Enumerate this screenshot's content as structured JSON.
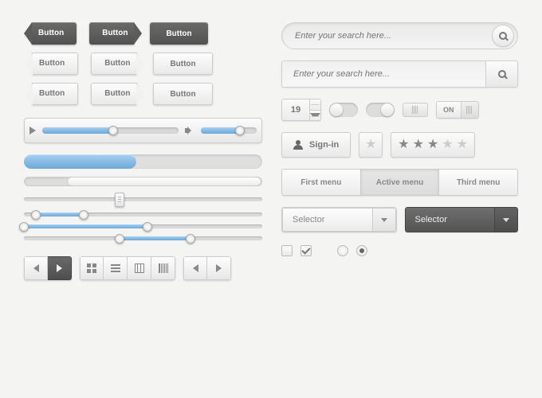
{
  "buttons": {
    "row1": [
      "Button",
      "Button",
      "Button"
    ],
    "row2": [
      "Button",
      "Button",
      "Button"
    ],
    "row3": [
      "Button",
      "Button",
      "Button"
    ]
  },
  "player": {
    "progress_pct": 52,
    "volume_pct": 70
  },
  "progress": {
    "a_pct": 47
  },
  "sliders": {
    "single_pct": 40,
    "dual_a": [
      5,
      25
    ],
    "dual_b": [
      0,
      52
    ],
    "dual_c": [
      40,
      70
    ]
  },
  "search": {
    "placeholder": "Enter your search here..."
  },
  "stepper": {
    "value": "19"
  },
  "on_switch": {
    "label": "ON"
  },
  "signin_label": "Sign-in",
  "rating": {
    "value": 3,
    "max": 5
  },
  "tabs": [
    "First menu",
    "Active menu",
    "Third menu"
  ],
  "active_tab_index": 1,
  "selectors": {
    "light": "Selector",
    "dark": "Selector"
  },
  "checks": {
    "cb1": false,
    "cb2": true,
    "rb1": false,
    "rb2": true
  }
}
